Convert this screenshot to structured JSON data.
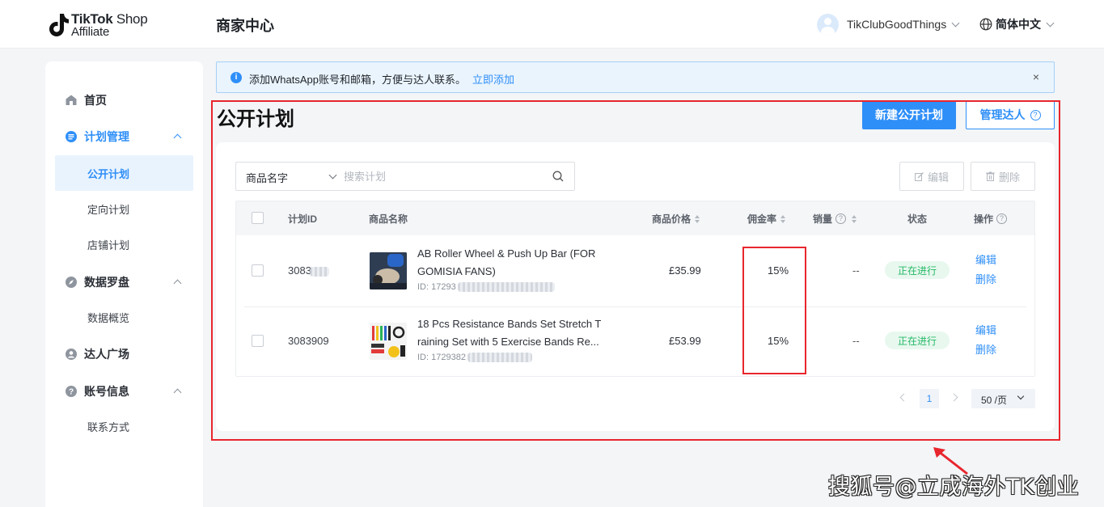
{
  "header": {
    "logo_line1_bold": "TikTok",
    "logo_line1_rest": " Shop",
    "logo_line2": "Affiliate",
    "title": "商家中心",
    "username": "TikClubGoodThings",
    "language": "简体中文"
  },
  "sidebar": {
    "items": [
      {
        "label": "首页",
        "icon": "home-icon"
      },
      {
        "label": "计划管理",
        "icon": "plan-icon",
        "expanded": true
      },
      {
        "label": "公开计划",
        "sub": true,
        "active": true
      },
      {
        "label": "定向计划",
        "sub": true
      },
      {
        "label": "店铺计划",
        "sub": true
      },
      {
        "label": "数据罗盘",
        "icon": "compass-icon",
        "expanded": true
      },
      {
        "label": "数据概览",
        "sub": true
      },
      {
        "label": "达人广场",
        "icon": "creator-icon"
      },
      {
        "label": "账号信息",
        "icon": "account-icon",
        "expanded": true
      },
      {
        "label": "联系方式",
        "sub": true
      }
    ]
  },
  "notice": {
    "text": "添加WhatsApp账号和邮箱，方便与达人联系。",
    "link": "立即添加",
    "close": "×"
  },
  "page": {
    "title": "公开计划",
    "new_button": "新建公开计划",
    "manage_button": "管理达人"
  },
  "search": {
    "select_value": "商品名字",
    "placeholder": "搜索计划"
  },
  "toolbar": {
    "edit": "编辑",
    "delete": "删除"
  },
  "table": {
    "columns": [
      "计划ID",
      "商品名称",
      "商品价格",
      "佣金率",
      "销量",
      "状态",
      "操作"
    ],
    "rows": [
      {
        "plan_id": "3083",
        "product_name_line1": "AB Roller Wheel & Push Up Bar (FOR",
        "product_name_line2": "GOMISIA FANS)",
        "product_id": "ID: 17293",
        "price": "£35.99",
        "commission": "15%",
        "sales": "--",
        "status": "正在进行",
        "op_edit": "编辑",
        "op_delete": "删除"
      },
      {
        "plan_id": "3083909",
        "product_name_line1": "18 Pcs Resistance Bands Set Stretch T",
        "product_name_line2": "raining Set with 5 Exercise Bands Re...",
        "product_id": "ID: 1729382",
        "price": "£53.99",
        "commission": "15%",
        "sales": "--",
        "status": "正在进行",
        "op_edit": "编辑",
        "op_delete": "删除"
      }
    ]
  },
  "pagination": {
    "current": "1",
    "page_size": "50 /页"
  },
  "watermark": "搜狐号@立成海外TK创业",
  "colors": {
    "accent": "#2f8ff8",
    "highlight_red": "#e8262d",
    "status_green": "#25b865"
  }
}
